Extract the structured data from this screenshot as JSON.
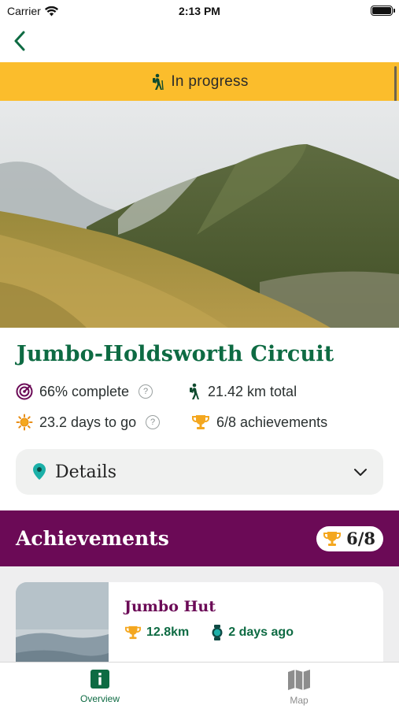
{
  "status_bar": {
    "carrier": "Carrier",
    "time": "2:13 PM"
  },
  "banner": {
    "label": "In progress",
    "color": "#fbbd2c"
  },
  "trail": {
    "title": "Jumbo-Holdsworth Circuit",
    "stats": {
      "completion": "66% complete",
      "distance": "21.42 km total",
      "remaining": "23.2 days to go",
      "achievements": "6/8 achievements"
    }
  },
  "details": {
    "label": "Details"
  },
  "achievements_section": {
    "title": "Achievements",
    "count": "6/8",
    "color": "#6b0a56",
    "items": [
      {
        "name": "Jumbo Hut",
        "distance": "12.8km",
        "time_ago": "2 days ago"
      }
    ]
  },
  "tab_bar": {
    "tabs": [
      {
        "label": "Overview",
        "icon": "info-icon",
        "active": true
      },
      {
        "label": "Map",
        "icon": "map-icon",
        "active": false
      }
    ]
  },
  "colors": {
    "primary_green": "#0e6b43",
    "accent_yellow": "#fbbd2c",
    "achievement_purple": "#6b0a56"
  }
}
